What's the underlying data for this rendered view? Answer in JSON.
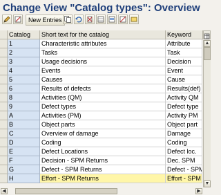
{
  "window": {
    "title": "Change View \"Catalog types\": Overview"
  },
  "toolbar": {
    "new_entries_label": "New Entries"
  },
  "table": {
    "columns": {
      "catalog": "Catalog",
      "text": "Short text for the catalog",
      "keyword": "Keyword"
    },
    "rows": [
      {
        "catalog": "1",
        "text": "Characteristic attributes",
        "keyword": "Attribute"
      },
      {
        "catalog": "2",
        "text": "Tasks",
        "keyword": "Task"
      },
      {
        "catalog": "3",
        "text": "Usage decisions",
        "keyword": "Decision"
      },
      {
        "catalog": "4",
        "text": "Events",
        "keyword": "Event"
      },
      {
        "catalog": "5",
        "text": "Causes",
        "keyword": "Cause"
      },
      {
        "catalog": "6",
        "text": "Results of defects",
        "keyword": "Results(def)"
      },
      {
        "catalog": "8",
        "text": "Activities (QM)",
        "keyword": "Activity QM"
      },
      {
        "catalog": "9",
        "text": "Defect types",
        "keyword": "Defect type"
      },
      {
        "catalog": "A",
        "text": "Activities (PM)",
        "keyword": "Activity PM"
      },
      {
        "catalog": "B",
        "text": "Object parts",
        "keyword": "Object part"
      },
      {
        "catalog": "C",
        "text": "Overview of damage",
        "keyword": "Damage"
      },
      {
        "catalog": "D",
        "text": "Coding",
        "keyword": "Coding"
      },
      {
        "catalog": "E",
        "text": "Defect Locations",
        "keyword": "Defect loc."
      },
      {
        "catalog": "F",
        "text": "Decision - SPM Returns",
        "keyword": "Dec. SPM"
      },
      {
        "catalog": "G",
        "text": "Defect - SPM Returns",
        "keyword": "Defect - SPM"
      },
      {
        "catalog": "H",
        "text": "Effort - SPM Returns",
        "keyword": "Effort - SPM"
      }
    ]
  }
}
